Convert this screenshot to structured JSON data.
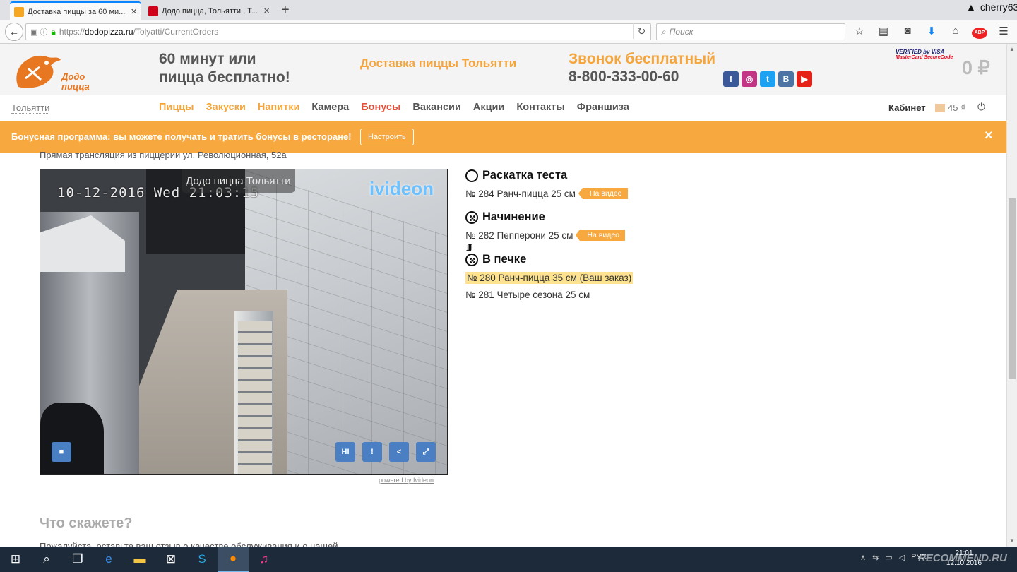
{
  "browser": {
    "tabs": [
      {
        "title": "Доставка пиццы за 60 ми...",
        "active": true
      },
      {
        "title": "Додо пицца, Тольятти , Т...",
        "active": false
      }
    ],
    "new_tab": "+",
    "user": "cherry63",
    "url": {
      "protocol": "https://",
      "host": "dodopizza.ru",
      "path": "/Tolyatti/CurrentOrders"
    },
    "search_placeholder": "Поиск"
  },
  "header": {
    "logo_text": "Додо пицца",
    "slogan_line1": "60 минут или",
    "slogan_line2": "пицца бесплатно!",
    "delivery": "Доставка пиццы Тольятти",
    "call_free": "Звонок бесплатный",
    "phone": "8-800-333-00-60",
    "social": [
      {
        "icon": "facebook-icon",
        "glyph": "f",
        "color": "#3b5998"
      },
      {
        "icon": "instagram-icon",
        "glyph": "◎",
        "color": "#c13584"
      },
      {
        "icon": "twitter-icon",
        "glyph": "t",
        "color": "#1da1f2"
      },
      {
        "icon": "vk-icon",
        "glyph": "В",
        "color": "#4c75a3"
      },
      {
        "icon": "youtube-icon",
        "glyph": "▶",
        "color": "#e62117"
      }
    ],
    "payment_verified": "VERIFIED by VISA",
    "payment_mc": "MasterCard SecureCode",
    "cart_total": "0 ₽"
  },
  "nav": {
    "city": "Тольятти",
    "items": [
      "Пиццы",
      "Закуски",
      "Напитки",
      "Камера",
      "Бонусы",
      "Вакансии",
      "Акции",
      "Контакты",
      "Франшиза"
    ],
    "cabinet": "Кабинет",
    "bonus_balance": "45"
  },
  "banner": {
    "text": "Бонусная программа: вы можете получать и тратить бонусы в ресторане!",
    "button": "Настроить",
    "close": "×"
  },
  "stream": {
    "subtitle": "Прямая трансляция из пиццерии ул. Революционная, 52а",
    "timestamp": "10-12-2016 Wed 21:03:15",
    "camera_title": "Додо пицца Тольятти",
    "brand": "ivideon",
    "controls": {
      "stop": "■",
      "hi": "HI",
      "alert": "!",
      "share": "<",
      "fullscreen": "⤢"
    },
    "powered_by": "powered by Ivideon"
  },
  "stages": [
    {
      "title": "Раскатка теста",
      "icon": "circle-icon",
      "orders": [
        {
          "text": "№ 284 Ранч-пицца 25 см",
          "tag": "На видео"
        }
      ]
    },
    {
      "title": "Начинение",
      "icon": "pizza-icon",
      "orders": [
        {
          "text": "№ 282 Пепперони 25 см",
          "tag": "На видео"
        }
      ]
    },
    {
      "title": "В печке",
      "icon": "hot-pizza-icon",
      "orders": [
        {
          "text": "№ 280 Ранч-пицца 35 см (Ваш заказ)",
          "highlight": true
        },
        {
          "text": "№ 281 Четыре сезона 25 см"
        }
      ]
    }
  ],
  "feedback": {
    "title": "Что скажете?",
    "text": "Пожалуйста, оставьте ваш отзыв о качестве обслуживания и о нашей"
  },
  "taskbar": {
    "time": "21:01",
    "date": "12.10.2016",
    "lang": "РУС",
    "watermark": "RECOMMEND.RU"
  }
}
